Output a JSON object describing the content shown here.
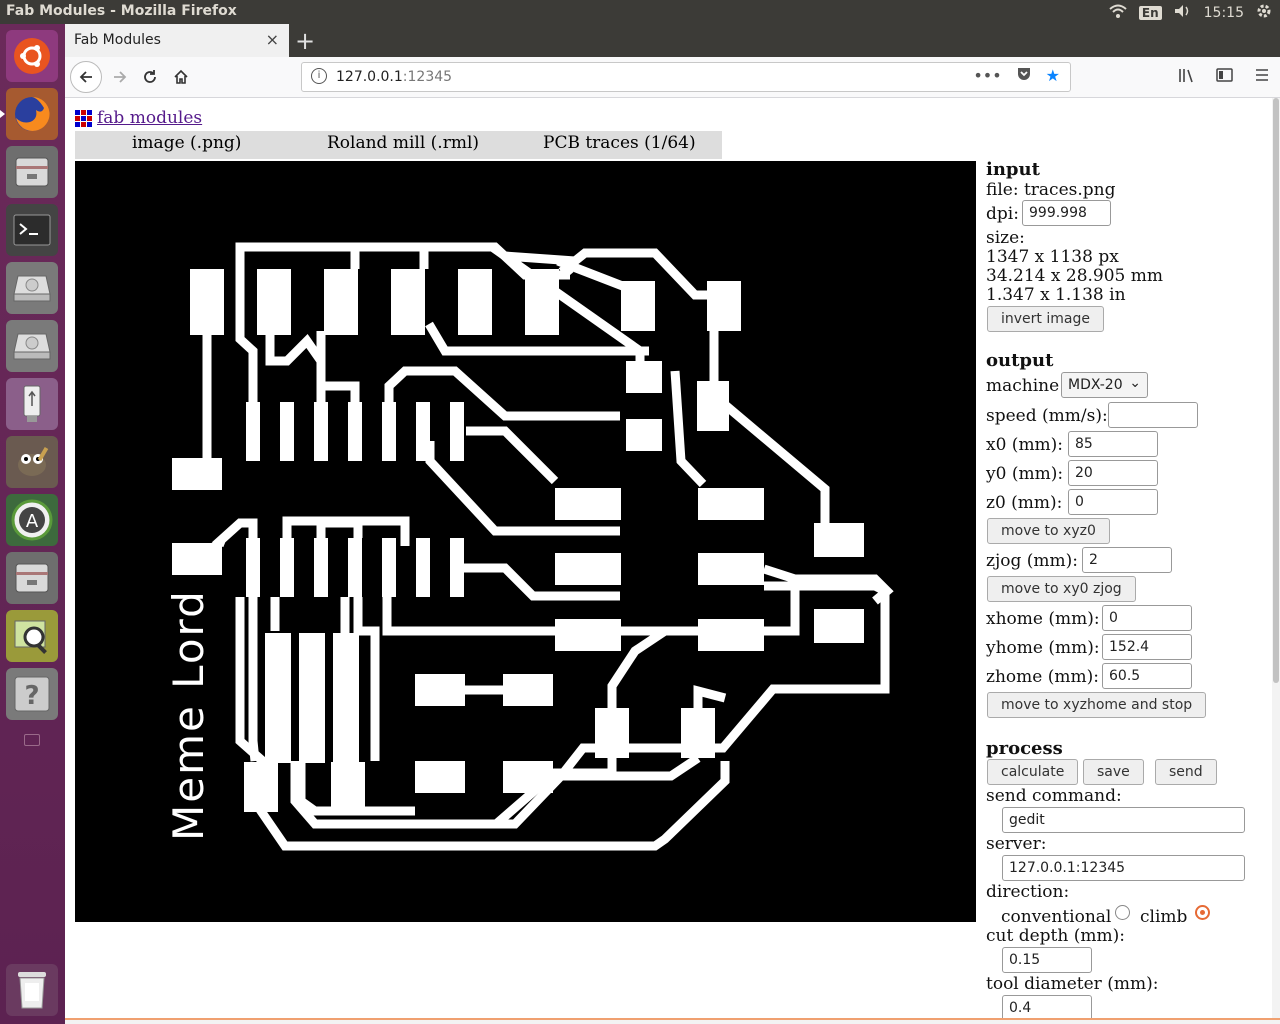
{
  "system": {
    "window_title": "Fab Modules - Mozilla Firefox",
    "keyboard_lang": "En",
    "clock": "15:15"
  },
  "launcher": {
    "items": [
      "ubuntu-icon",
      "firefox-icon",
      "files-icon",
      "terminal-icon",
      "disk-icon",
      "disk-icon",
      "usb-icon",
      "gimp-icon",
      "software-updater-icon",
      "files-icon",
      "image-viewer-icon",
      "help-icon",
      "trash-icon"
    ]
  },
  "browser": {
    "tab_title": "Fab Modules",
    "tab_close": "×",
    "new_tab": "+",
    "url_host": "127.0.0.1",
    "url_port": ":12345",
    "page_actions": "•••"
  },
  "page": {
    "logo_link": "fab modules",
    "menu": [
      "image (.png)",
      "Roland mill (.rml)",
      "PCB traces (1/64)"
    ],
    "canvas_text": "Meme Lord",
    "input": {
      "heading": "input",
      "file": "file: traces.png",
      "dpi_label": "dpi:",
      "dpi": "999.998",
      "size_label": "size:",
      "size_px": "1347 x 1138 px",
      "size_mm": "34.214 x 28.905 mm",
      "size_in": "1.347 x 1.138 in",
      "invert_button": "invert image"
    },
    "output": {
      "heading": "output",
      "machine_label": "machine",
      "machine": "MDX-20",
      "speed_label": "speed (mm/s):",
      "speed": "",
      "x0_label": "x0 (mm):",
      "x0": "85",
      "y0_label": "y0 (mm):",
      "y0": "20",
      "z0_label": "z0 (mm):",
      "z0": "0",
      "move_xyz0": "move to xyz0",
      "zjog_label": "zjog (mm):",
      "zjog": "2",
      "move_xy0_zjog": "move to xy0 zjog",
      "xhome_label": "xhome (mm):",
      "xhome": "0",
      "yhome_label": "yhome (mm):",
      "yhome": "152.4",
      "zhome_label": "zhome (mm):",
      "zhome": "60.5",
      "move_home": "move to xyzhome and stop"
    },
    "process": {
      "heading": "process",
      "calculate": "calculate",
      "save": "save",
      "send": "send",
      "send_command_label": "send command:",
      "send_command": "gedit",
      "server_label": "server:",
      "server": "127.0.0.1:12345",
      "direction_label": "direction:",
      "conventional": "conventional",
      "climb": "climb",
      "direction_selected": "climb",
      "cut_depth_label": "cut depth (mm):",
      "cut_depth": "0.15",
      "tool_diameter_label": "tool diameter (mm):",
      "tool_diameter": "0.4"
    }
  }
}
